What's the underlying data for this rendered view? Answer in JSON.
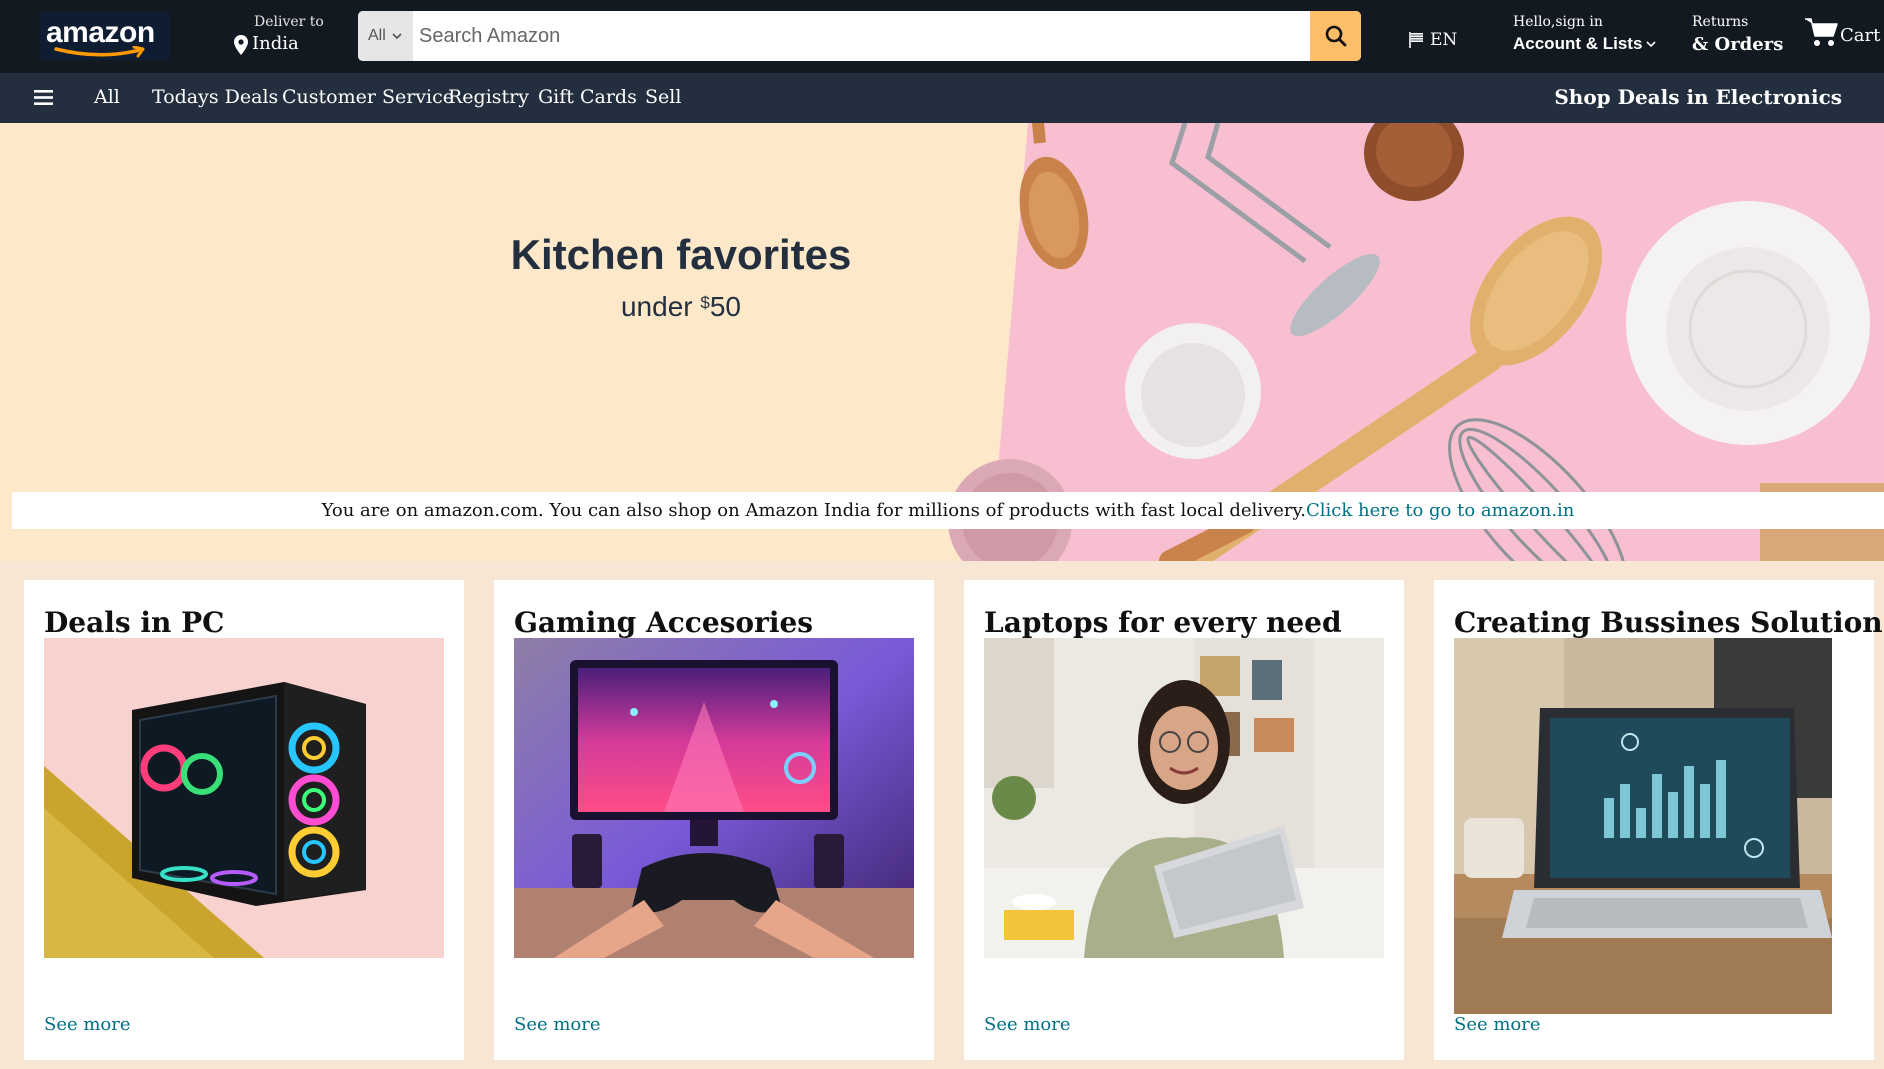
{
  "header": {
    "logo_text": "amazon",
    "deliver_small": "Deliver to",
    "deliver_location": "India",
    "search": {
      "category": "All",
      "placeholder": "Search Amazon",
      "value": ""
    },
    "language": "EN",
    "account_small": "Hello,sign in",
    "account_big": "Account & Lists",
    "returns_small": "Returns",
    "orders_big": "& Orders",
    "cart_label": "Cart"
  },
  "subnav": {
    "items": [
      "All",
      "Todays Deals",
      "Customer Service",
      "Registry",
      "Gift Cards",
      "Sell"
    ],
    "promo": "Shop Deals in Electronics"
  },
  "hero": {
    "title": "Kitchen favorites",
    "sub_prefix": "under ",
    "currency": "$",
    "amount": "50"
  },
  "notice": {
    "text": "You are on amazon.com. You can also shop on Amazon India for millions of products with fast local delivery.",
    "link": "Click here to go to amazon.in"
  },
  "cards": [
    {
      "title": "Deals in PC",
      "image_icon": "gaming-pc-image",
      "link": "See more"
    },
    {
      "title": "Gaming Accesories",
      "image_icon": "gaming-controller-image",
      "link": "See more"
    },
    {
      "title": "Laptops for every need",
      "image_icon": "woman-laptop-image",
      "link": "See more"
    },
    {
      "title": "Creating Bussines Solution",
      "image_icon": "laptop-dashboard-image",
      "link": "See more"
    }
  ],
  "colors": {
    "topbar": "#131921",
    "subnav": "#232f3e",
    "search_button": "#febd69",
    "link": "#007185",
    "hero_left": "#fde9c9",
    "hero_right": "#f7bfd0",
    "page_bg": "#f7e6d3"
  }
}
